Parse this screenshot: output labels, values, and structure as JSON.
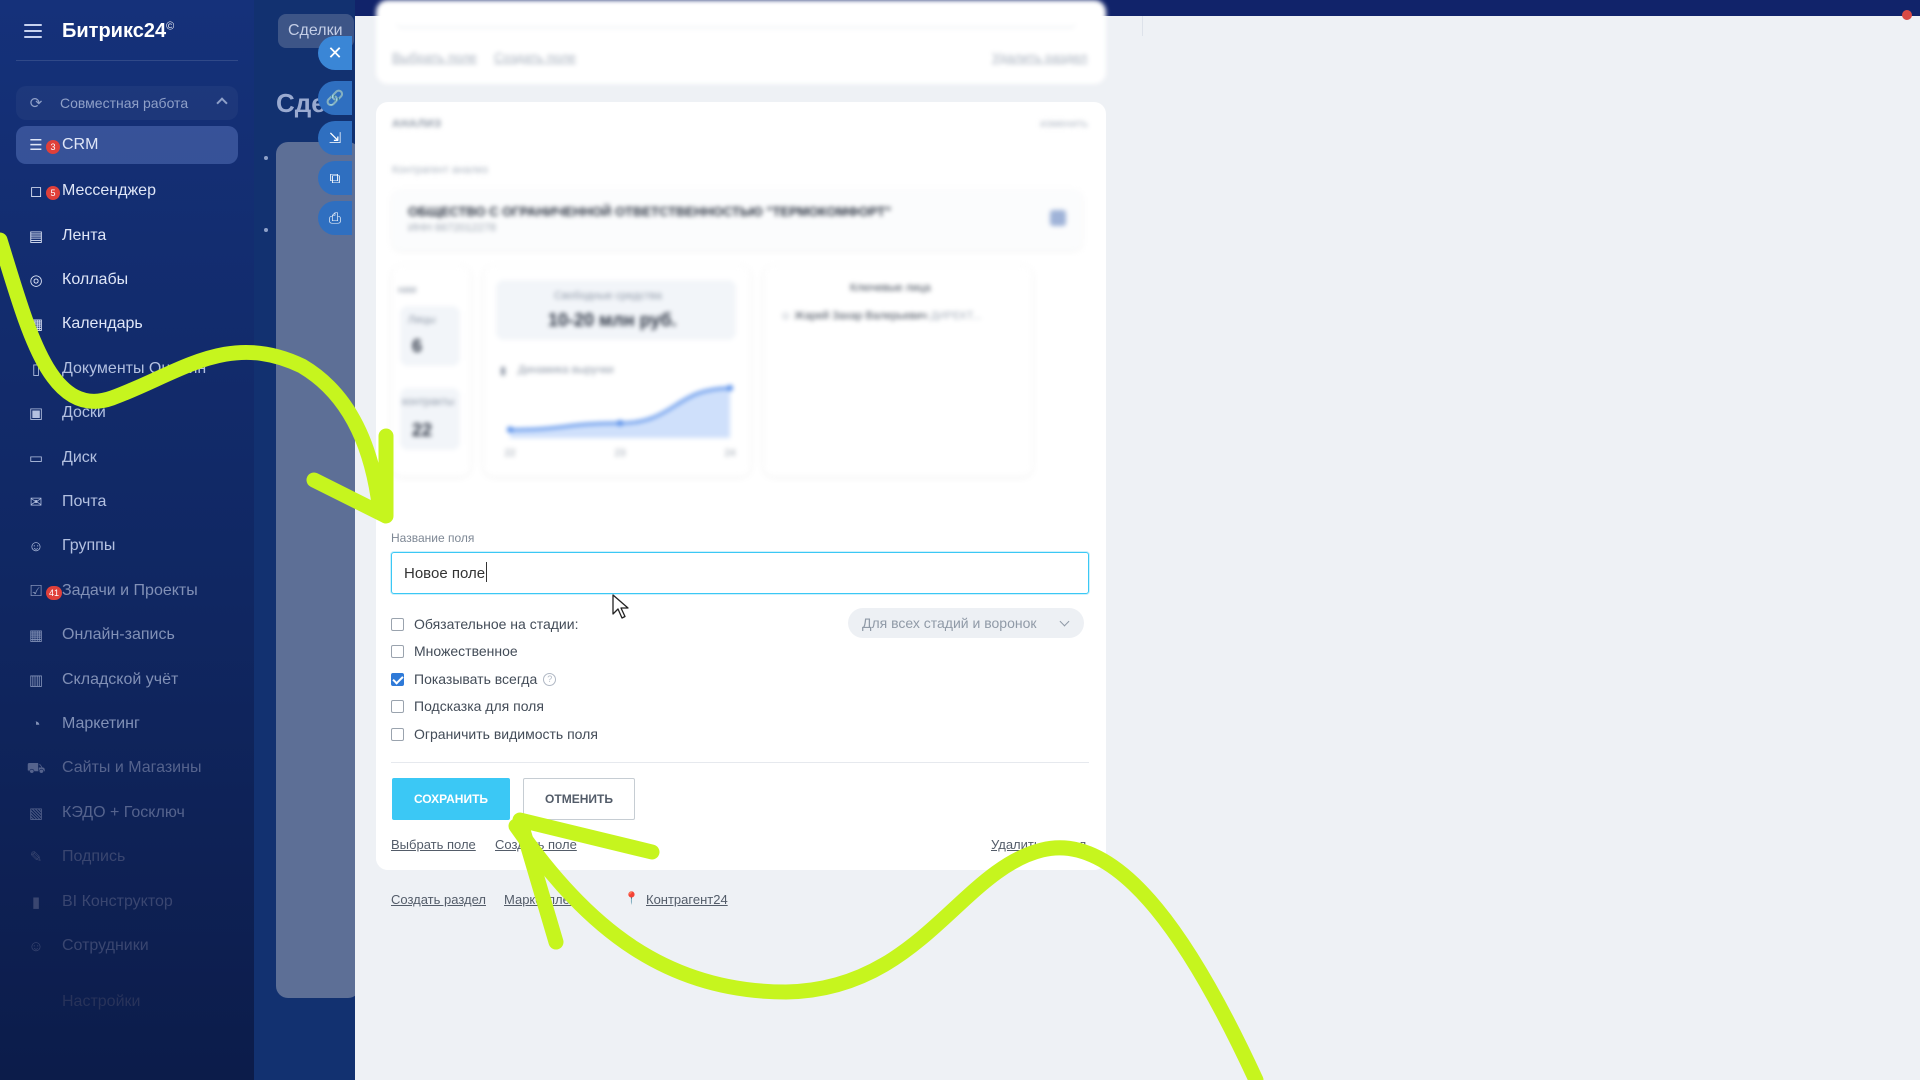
{
  "sidebar": {
    "logo": "Битрикс24",
    "logo_mark": "©",
    "group_label": "Совместная работа",
    "items": [
      {
        "label": "CRM",
        "badge": "3"
      },
      {
        "label": "Мессенджер",
        "badge": "5"
      },
      {
        "label": "Лента",
        "badge": ""
      },
      {
        "label": "Коллабы",
        "badge": ""
      },
      {
        "label": "Календарь",
        "badge": ""
      },
      {
        "label": "Документы Онлайн",
        "badge": ""
      },
      {
        "label": "Доски",
        "badge": ""
      },
      {
        "label": "Диск",
        "badge": ""
      },
      {
        "label": "Почта",
        "badge": ""
      },
      {
        "label": "Группы",
        "badge": ""
      },
      {
        "label": "Задачи и Проекты",
        "badge": "41"
      },
      {
        "label": "Онлайн-запись",
        "badge": ""
      },
      {
        "label": "Складской учёт",
        "badge": ""
      },
      {
        "label": "Маркетинг",
        "badge": ""
      },
      {
        "label": "Сайты и Магазины",
        "badge": ""
      },
      {
        "label": "КЭДО + Госключ",
        "badge": ""
      },
      {
        "label": "Подпись",
        "badge": ""
      },
      {
        "label": "BI Конструктор",
        "badge": ""
      },
      {
        "label": "Сотрудники",
        "badge": ""
      },
      {
        "label": "Настройки",
        "badge": ""
      }
    ]
  },
  "background_page": {
    "tab": "Сделки",
    "title": "Сде"
  },
  "tools": [
    "close-icon",
    "link-icon",
    "download-icon",
    "external-link-icon",
    "print-icon"
  ],
  "top_section": {
    "select_field": "Выбрать поле",
    "create_field": "Создать поле",
    "delete_section": "Удалить раздел"
  },
  "analysis": {
    "title": "АНАЛИЗ",
    "edit": "изменить",
    "subtitle": "Контрагент анализ",
    "company": {
      "name": "ОБЩЕСТВО С ОГРАНИЧЕННОЙ ОТВЕТСТВЕННОСТЬЮ \"ТЕРМОКОМФОРТ\"",
      "inn": "ИНН 6672012278"
    },
    "col1_title": "нии",
    "stat_a_label": "Лицы",
    "stat_a_value": "6",
    "stat_b_label": "контракты",
    "stat_b_value": "22",
    "funds_label": "Свободные средства",
    "funds_value": "10-20 млн руб.",
    "revenue_label": "Динамика выручки",
    "key_persons_title": "Ключевые лица",
    "person_name": "Жарей Захар Валерьевич",
    "person_role": "ДИРЕКТ..."
  },
  "chart_data": {
    "type": "area",
    "title": "Динамика выручки",
    "categories": [
      "22",
      "23",
      "24"
    ],
    "values": [
      1.0,
      1.8,
      6.0
    ]
  },
  "form": {
    "field_label": "Название поля",
    "field_value": "Новое поле",
    "checks": [
      {
        "label": "Обязательное на стадии:",
        "checked": false
      },
      {
        "label": "Множественное",
        "checked": false
      },
      {
        "label": "Показывать всегда",
        "checked": true
      },
      {
        "label": "Подсказка для поля",
        "checked": false
      },
      {
        "label": "Ограничить видимость поля",
        "checked": false
      }
    ],
    "stage_select": "Для всех стадий и воронок",
    "save": "СОХРАНИТЬ",
    "cancel": "ОТМЕНИТЬ",
    "select_field": "Выбрать поле",
    "create_field": "Создать поле",
    "delete_section": "Удалить раздел"
  },
  "footer": {
    "create_section": "Создать раздел",
    "marketplace": "Маркетплейс",
    "kontragent": "Контрагент24"
  },
  "colors": {
    "accent": "#3bc8f5",
    "annotation": "#c6f51e",
    "sidebar": "#15317a"
  }
}
